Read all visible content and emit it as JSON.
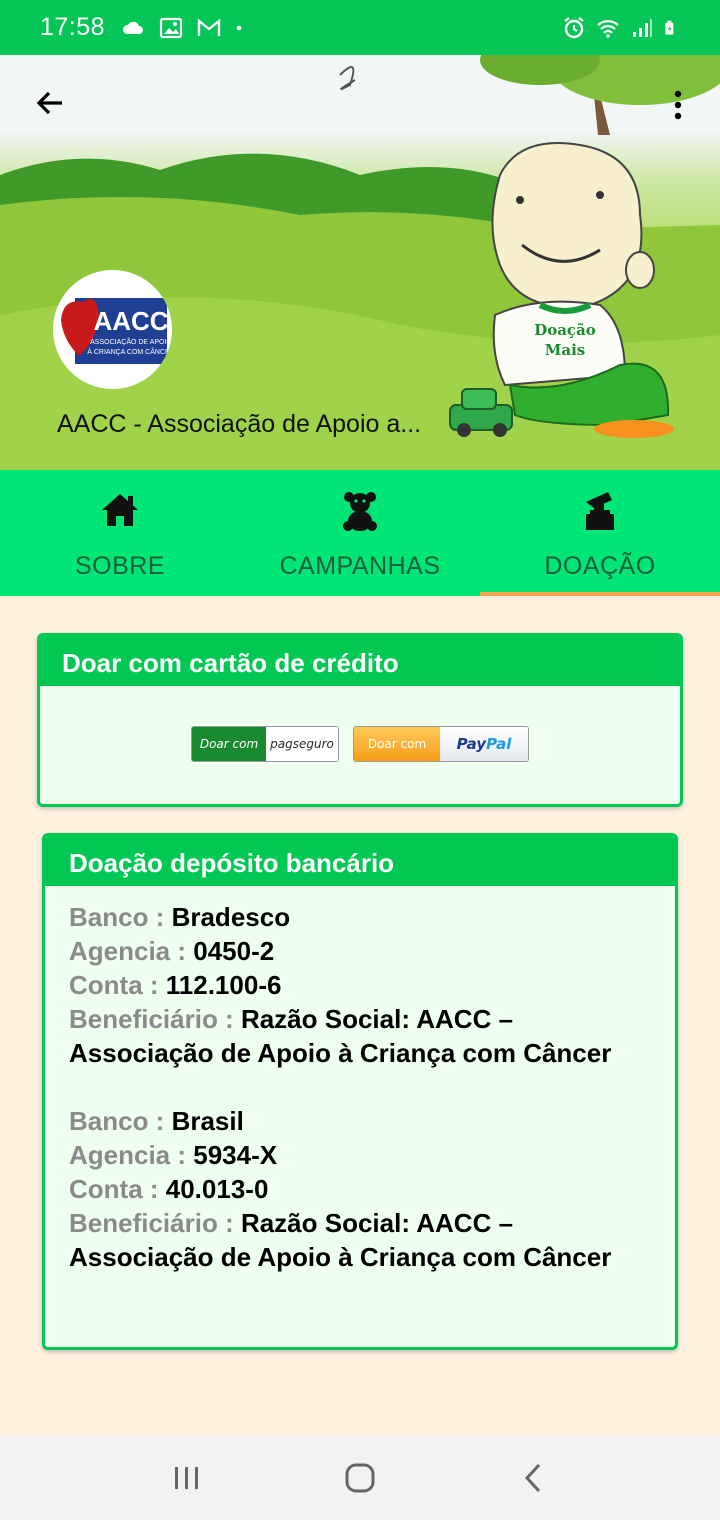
{
  "status_bar": {
    "time": "17:58",
    "left_icons": [
      "cloud-icon",
      "image-icon",
      "gmail-icon",
      "dot-icon"
    ],
    "right_icons": [
      "alarm-icon",
      "wifi-icon",
      "signal-icon",
      "battery-icon"
    ]
  },
  "header": {
    "org_name": "AACC - Associação de Apoio a...",
    "logo_text": "AACC",
    "logo_subtext": "ASSOCIAÇÃO DE APOIO À CRIANÇA COM CÂNCER",
    "mascot_shirt_text": "Doação Mais"
  },
  "tabs": [
    {
      "label": "SOBRE",
      "icon": "home-icon",
      "active": false
    },
    {
      "label": "CAMPANHAS",
      "icon": "teddy-bear-icon",
      "active": false
    },
    {
      "label": "DOAÇÃO",
      "icon": "donation-box-icon",
      "active": true
    }
  ],
  "credit_card": {
    "title": "Doar com cartão de crédito",
    "pagseguro_left": "Doar com",
    "pagseguro_right": "pagseguro",
    "paypal_left": "Doar com",
    "paypal_right_a": "Pay",
    "paypal_right_b": "Pal"
  },
  "bank_deposit": {
    "title": "Doação depósito bancário",
    "accounts": [
      {
        "bank_label": "Banco : ",
        "bank": "Bradesco",
        "agency_label": "Agencia : ",
        "agency": "0450-2",
        "account_label": "Conta : ",
        "account": "112.100-6",
        "beneficiary_label": "Beneficiário : ",
        "beneficiary": "Razão Social: AACC – Associação de Apoio à Criança com Câncer"
      },
      {
        "bank_label": "Banco : ",
        "bank": "Brasil",
        "agency_label": "Agencia : ",
        "agency": "5934-X",
        "account_label": "Conta : ",
        "account": "40.013-0",
        "beneficiary_label": "Beneficiário : ",
        "beneficiary": "Razão Social: AACC – Associação de Apoio à Criança com Câncer"
      }
    ]
  },
  "colors": {
    "status_bar": "#05c556",
    "tab_bar": "#00e676",
    "card_header": "#00c853",
    "active_tab_indicator": "#f6a54c",
    "page_background": "#fdf0dd"
  }
}
